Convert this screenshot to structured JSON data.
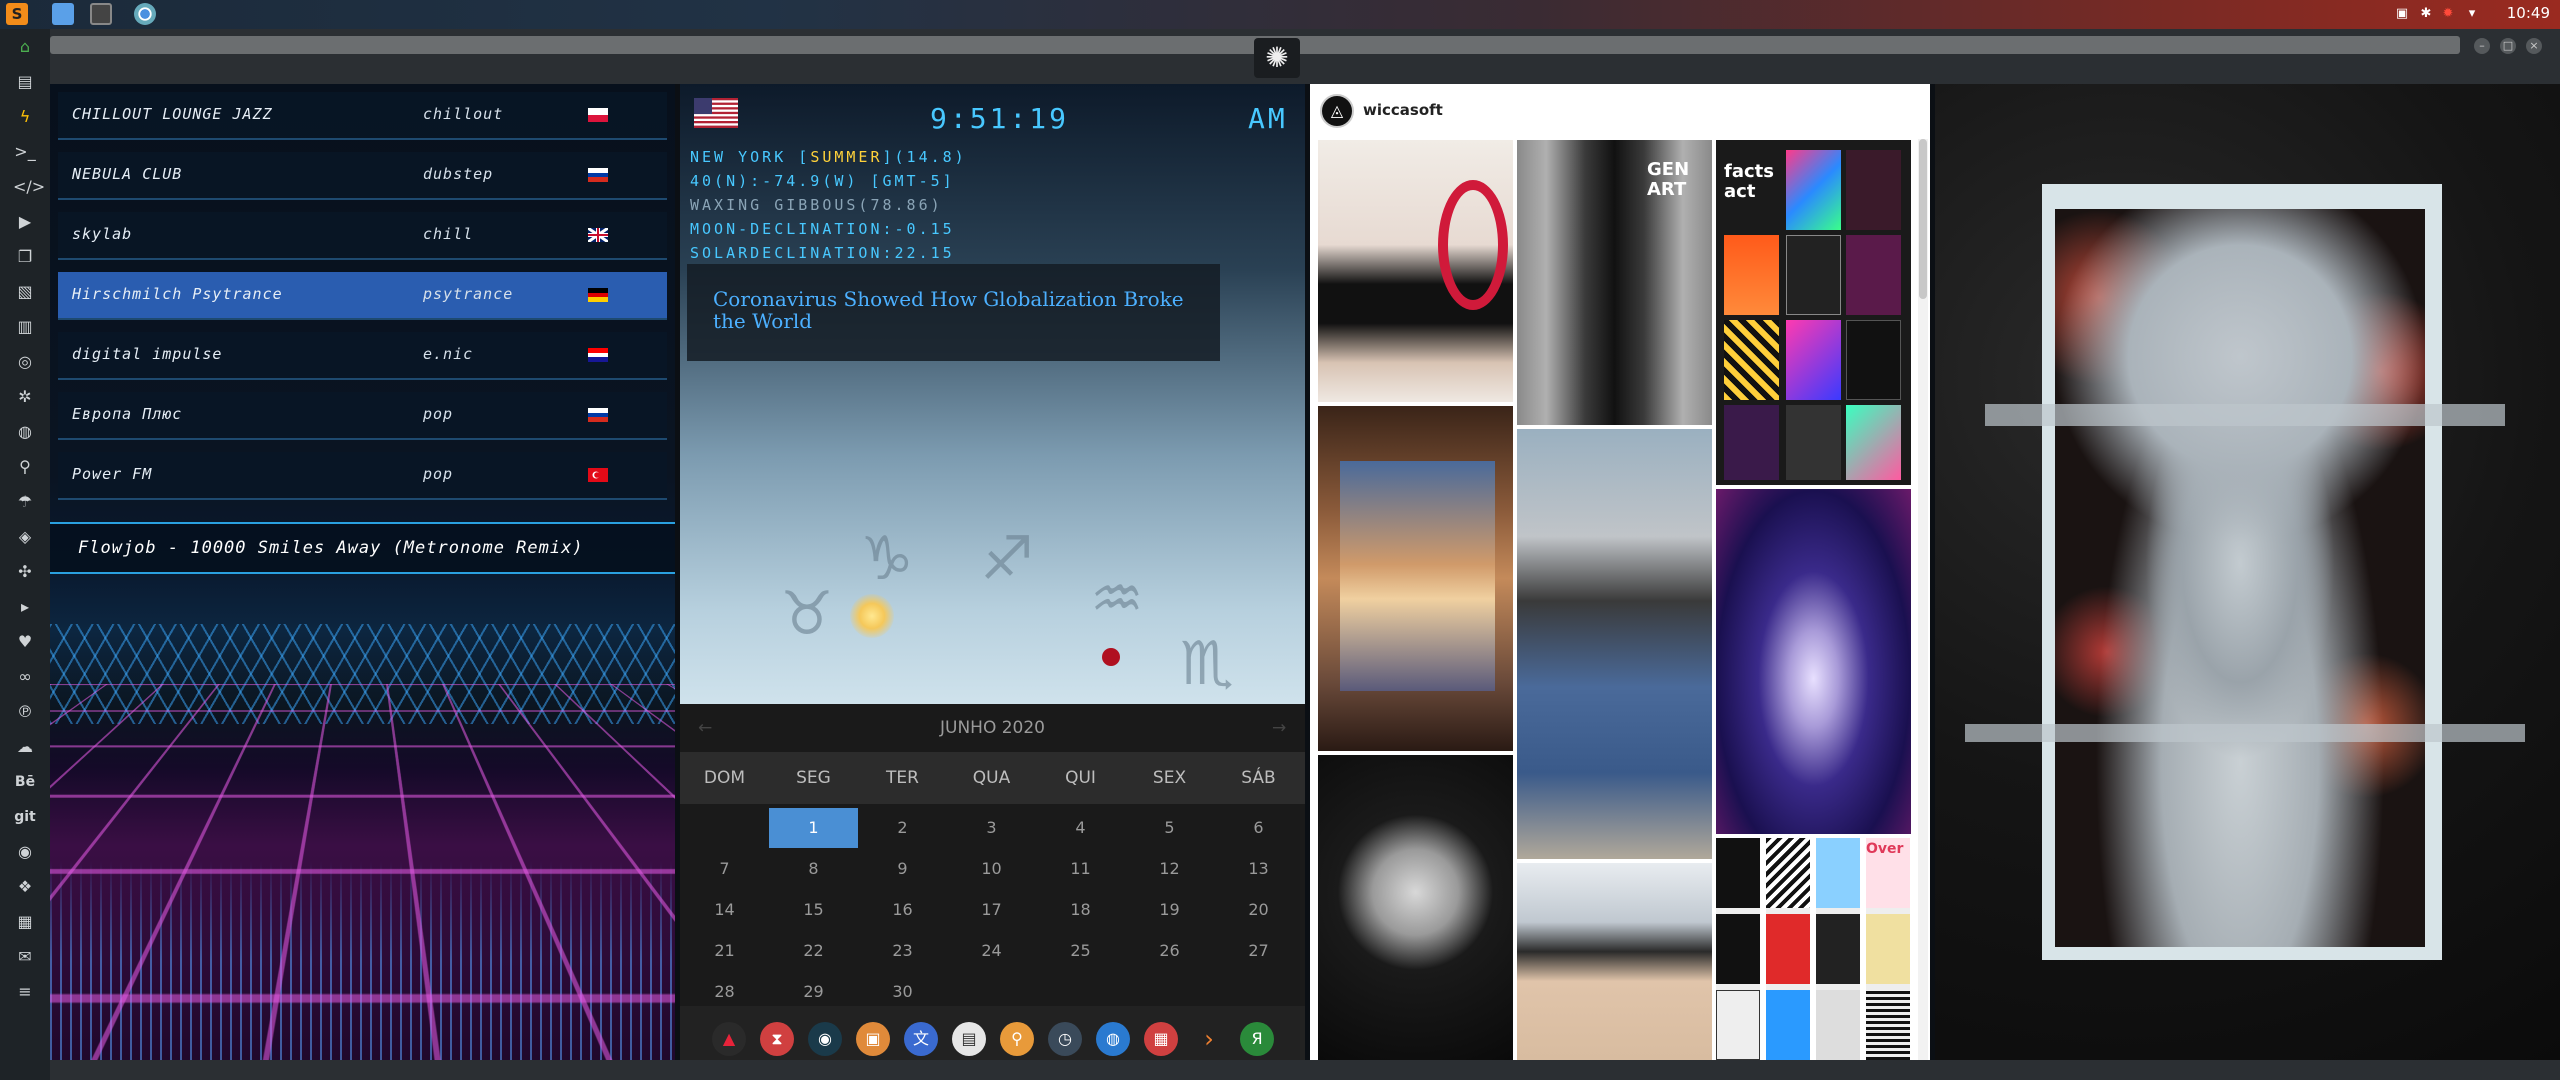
{
  "topbar": {
    "clock": "10:49",
    "tray_icons": [
      "image-icon",
      "bluetooth-icon",
      "settings-gear-icon",
      "wifi-icon"
    ]
  },
  "window": {
    "controls": [
      "minimize",
      "maximize",
      "close"
    ]
  },
  "radio": {
    "stations": [
      {
        "name": "CHILLOUT LOUNGE JAZZ",
        "genre": "chillout",
        "flag": "PL"
      },
      {
        "name": "NEBULA CLUB",
        "genre": "dubstep",
        "flag": "RU"
      },
      {
        "name": "skylab",
        "genre": "chill",
        "flag": "GB"
      },
      {
        "name": "Hirschmilch Psytrance",
        "genre": "psytrance",
        "flag": "DE"
      },
      {
        "name": "digital impulse",
        "genre": "e.nic",
        "flag": "HR"
      },
      {
        "name": "Европа Плюс",
        "genre": "pop",
        "flag": "RU"
      },
      {
        "name": "Power FM",
        "genre": "pop",
        "flag": "TR"
      }
    ],
    "active_index": 3,
    "now_playing": "Flowjob - 10000 Smiles Away (Metronome Remix)"
  },
  "clock": {
    "time": "9:51:19",
    "ampm": "AM",
    "city_prefix": "NEW YORK [",
    "season": "SUMMER",
    "city_suffix": "](14.8)",
    "coords": "40(N):-74.9(W) [GMT-5]",
    "moon_phase": "WAXING GIBBOUS(78.86)",
    "moon_declination": "MOON-DECLINATION:-0.15",
    "solar_declination": "SOLARDECLINATION:22.15",
    "news_headline": "Coronavirus Showed How Globalization Broke the World"
  },
  "calendar": {
    "month_label": "JUNHO 2020",
    "weekdays": [
      "DOM",
      "SEG",
      "TER",
      "QUA",
      "QUI",
      "SEX",
      "SÁB"
    ],
    "weeks": [
      [
        "",
        "1",
        "2",
        "3",
        "4",
        "5",
        "6"
      ],
      [
        "7",
        "8",
        "9",
        "10",
        "11",
        "12",
        "13"
      ],
      [
        "14",
        "15",
        "16",
        "17",
        "18",
        "19",
        "20"
      ],
      [
        "21",
        "22",
        "23",
        "24",
        "25",
        "26",
        "27"
      ],
      [
        "28",
        "29",
        "30",
        "",
        "",
        "",
        ""
      ]
    ],
    "selected": "1"
  },
  "pinterest": {
    "username": "wiccasoft",
    "caption_thumb_1": "facts act",
    "caption_thumb_2": "GEN ART",
    "caption_thumb_3": "Over"
  },
  "dock_apps": [
    "adobe-icon",
    "hourglass-icon",
    "earth-icon",
    "image-viewer-icon",
    "translate-icon",
    "news-icon",
    "search-icon",
    "clock-icon",
    "globe-icon",
    "calendar-icon",
    "terminal-icon",
    "yandex-icon"
  ]
}
